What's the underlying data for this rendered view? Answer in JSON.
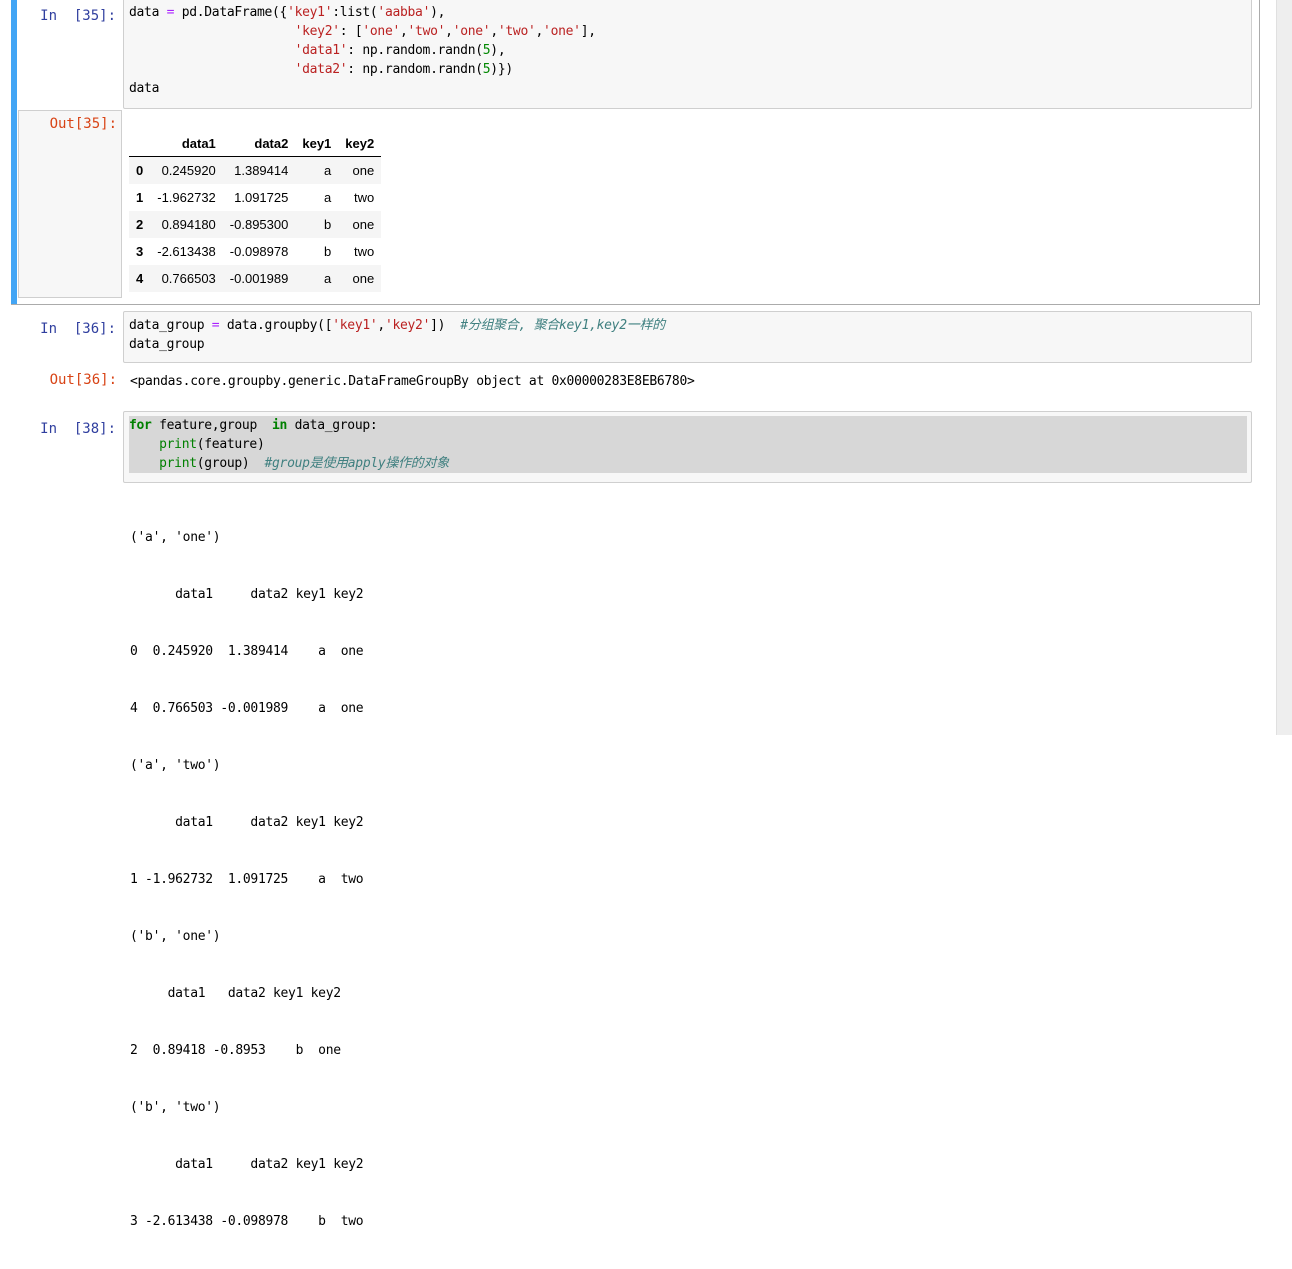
{
  "cell35": {
    "in_prompt": "In  [35]:",
    "out_prompt": "Out[35]:",
    "code": {
      "l1a": "data ",
      "l1eq": "=",
      "l1b": " pd.DataFrame({",
      "l1s1": "'key1'",
      "l1c": ":list(",
      "l1s2": "'aabba'",
      "l1d": "),",
      "l2indent": "                      ",
      "l2s1": "'key2'",
      "l2b": ": [",
      "l2s2": "'one'",
      "l2c1": ",",
      "l2s3": "'two'",
      "l2c2": ",",
      "l2s4": "'one'",
      "l2c3": ",",
      "l2s5": "'two'",
      "l2c4": ",",
      "l2s6": "'one'",
      "l2d": "],",
      "l3indent": "                      ",
      "l3s1": "'data1'",
      "l3b": ": np.random.randn(",
      "l3n": "5",
      "l3c": "),",
      "l4indent": "                      ",
      "l4s1": "'data2'",
      "l4b": ": np.random.randn(",
      "l4n": "5",
      "l4c": ")})",
      "l5": "data"
    },
    "table": {
      "columns": [
        "",
        "data1",
        "data2",
        "key1",
        "key2"
      ],
      "rows": [
        [
          "0",
          "0.245920",
          "1.389414",
          "a",
          "one"
        ],
        [
          "1",
          "-1.962732",
          "1.091725",
          "a",
          "two"
        ],
        [
          "2",
          "0.894180",
          "-0.895300",
          "b",
          "one"
        ],
        [
          "3",
          "-2.613438",
          "-0.098978",
          "b",
          "two"
        ],
        [
          "4",
          "0.766503",
          "-0.001989",
          "a",
          "one"
        ]
      ]
    }
  },
  "cell36": {
    "in_prompt": "In  [36]:",
    "out_prompt": "Out[36]:",
    "code": {
      "l1a": "data_group ",
      "l1eq": "=",
      "l1b": " data.groupby([",
      "l1s1": "'key1'",
      "l1c": ",",
      "l1s2": "'key2'",
      "l1d": "])  ",
      "l1cm": "#分组聚合, 聚合key1,key2一样的",
      "l2": "data_group"
    },
    "output": "<pandas.core.groupby.generic.DataFrameGroupBy object at 0x00000283E8EB6780>"
  },
  "cell38": {
    "in_prompt": "In  [38]:",
    "code": {
      "l1kw1": "for",
      "l1a": " feature,group  ",
      "l1kw2": "in",
      "l1b": " data_group:",
      "l2indent": "    ",
      "l2bi": "print",
      "l2a": "(feature)",
      "l3indent": "    ",
      "l3bi": "print",
      "l3a": "(group)  ",
      "l3cm": "#group是使用apply操作的对象"
    },
    "output_lines": [
      "('a', 'one')",
      "      data1     data2 key1 key2",
      "0  0.245920  1.389414    a  one",
      "4  0.766503 -0.001989    a  one",
      "('a', 'two')",
      "      data1     data2 key1 key2",
      "1 -1.962732  1.091725    a  two",
      "('b', 'one')",
      "     data1   data2 key1 key2",
      "2  0.89418 -0.8953    b  one",
      "('b', 'two')",
      "      data1     data2 key1 key2",
      "3 -2.613438 -0.098978    b  two"
    ]
  },
  "colors": {
    "selected_bar": "#42a5f5",
    "in_prompt": "#303f9f",
    "out_prompt": "#d84315",
    "string": "#ba2121",
    "keyword": "#008000",
    "comment": "#408080"
  }
}
